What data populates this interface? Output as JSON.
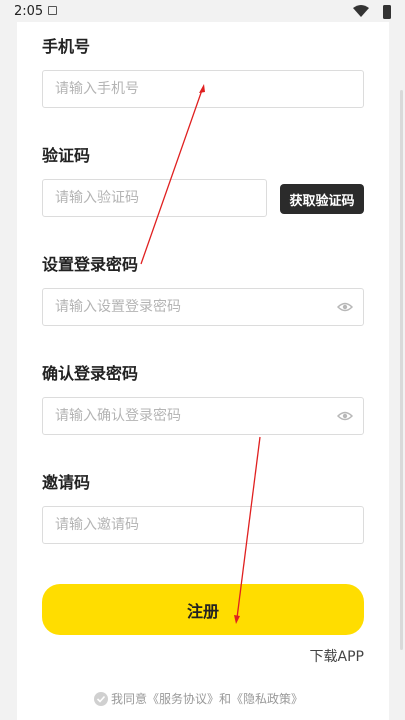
{
  "status_bar": {
    "time": "2:05"
  },
  "form": {
    "phone": {
      "label": "手机号",
      "placeholder": "请输入手机号"
    },
    "verification_code": {
      "label": "验证码",
      "placeholder": "请输入验证码",
      "button_label": "获取验证码"
    },
    "password": {
      "label": "设置登录密码",
      "placeholder": "请输入设置登录密码"
    },
    "confirm_password": {
      "label": "确认登录密码",
      "placeholder": "请输入确认登录密码"
    },
    "invite_code": {
      "label": "邀请码",
      "placeholder": "请输入邀请码"
    },
    "register_label": "注册",
    "download_label": "下载APP",
    "agreement": {
      "prefix": "我同意",
      "terms": "《服务协议》",
      "conjunction": "和",
      "privacy": "《隐私政策》"
    }
  },
  "colors": {
    "accent": "#ffdd00",
    "dark_button": "#2b2b2b",
    "annotation_arrow": "#e02020"
  },
  "icons": [
    "app-notification-icon",
    "wifi-icon",
    "battery-icon",
    "eye-icon",
    "check-circle-icon"
  ]
}
